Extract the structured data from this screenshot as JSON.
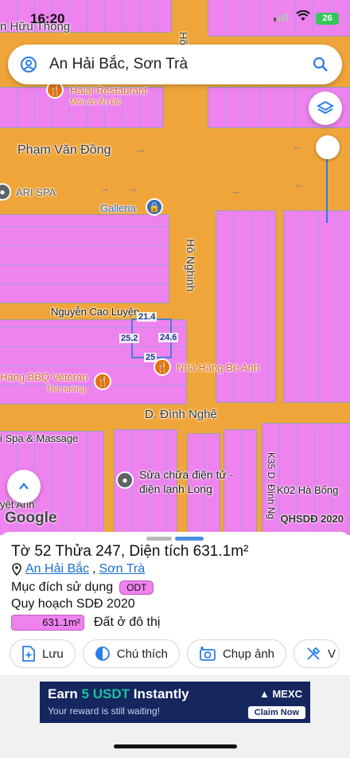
{
  "status": {
    "time": "16:20",
    "battery": "26"
  },
  "search": {
    "text": "An Hải Bắc, Sơn Trà"
  },
  "map": {
    "streets": {
      "top": "n Hữu Thông",
      "pham_van_dong": "Phạm Văn Đồng",
      "ho_nghinh_top": "Hồ Nghinh",
      "ho_nghinh": "Hồ Nghinh",
      "nguyen_cao_luyen": "Nguyễn Cao Luyện",
      "dinh_nghe": "D. Đình Nghệ",
      "k35": "K35 D. Đình Ng",
      "k02": "K02 Hà Bổng"
    },
    "pois": {
      "halal": "Halal Restaurant",
      "halal_sub": "Món ăn Ấn Độ",
      "ari_spa": "ARI SPA",
      "galleria": "Galleria",
      "bbq": "Hàng BBQ Veteran",
      "bbq_sub": "Thịt nướng",
      "be_anh": "Nhà Hàng Bé Anh",
      "spa_massage": "i Spa & Massage",
      "repair_1": "Sửa chữa điện tử -",
      "repair_2": "điện lạnh Long",
      "viet_anh": "yệt Anh"
    },
    "parcel_dims": {
      "top": "21.4",
      "left": "25.2",
      "right": "24.6",
      "bottom": "25"
    },
    "attribution": "Google",
    "layer_name": "QHSDĐ 2020"
  },
  "sheet": {
    "title": "Tờ 52 Thửa 247, Diện tích 631.1m²",
    "location_1": "An Hải Bắc",
    "location_sep": ",",
    "location_2": "Sơn Trà",
    "purpose_label": "Mục đích sử dụng",
    "purpose_code": "ODT",
    "plan_label": "Quy hoạch SDĐ 2020",
    "area_value": "631.1m²",
    "area_desc": "Đất ở đô thị",
    "actions": {
      "save": "Lưu",
      "legend": "Chú thích",
      "photo": "Chụp ảnh",
      "more": "V"
    }
  },
  "ad": {
    "headline_pre": "Earn ",
    "headline_accent": "5 USDT",
    "headline_post": " Instantly",
    "subline": "Your reward is still waiting!",
    "brand": "MEXC",
    "cta": "Claim Now"
  },
  "colors": {
    "road": "#f0a53a",
    "land": "#ee82ee",
    "accent": "#2b7de9"
  }
}
